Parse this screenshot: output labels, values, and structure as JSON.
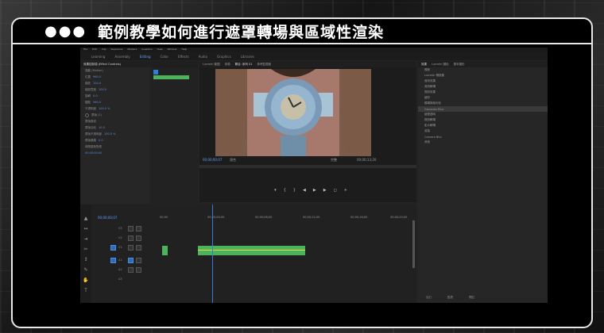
{
  "header": {
    "dots": "●●●",
    "title": "範例教學如何進行遮罩轉場與區域性渲染"
  },
  "menu": [
    "File",
    "Edit",
    "Clip",
    "Sequence",
    "Markers",
    "Graphics",
    "View",
    "Window",
    "Help"
  ],
  "workspaces": [
    "Learning",
    "Assembly",
    "Editing",
    "Color",
    "Effects",
    "Audio",
    "Graphics",
    "Libraries"
  ],
  "effect_controls": {
    "tab": "效果控制項 (Effect Controls)",
    "timecode": "00:00:00:00",
    "rows": [
      "運動 (Motion)",
      "位置",
      "縮放",
      "縮放寬度",
      "旋轉",
      "錨點",
      "不透明度",
      "蒙版 (1)",
      "蒙版路徑",
      "蒙版羽化",
      "蒙版不透明度",
      "蒙版擴展",
      "時間重新對應"
    ],
    "values": [
      "960.0",
      "100.0",
      "100.0",
      "0.0",
      "960.0",
      "100.0 %",
      "",
      "",
      "10.0",
      "100.0 %",
      "0.0"
    ]
  },
  "monitor": {
    "tabs": [
      "Lumetri 範圍",
      "來源",
      "節目: 序列 01",
      "參考監視器"
    ],
    "tc_left": "00;00;00;07",
    "fit": "適合",
    "quality": "完整",
    "tc_right": "00;00;13;20"
  },
  "project": {
    "tabs": [
      "效果",
      "Lumetri 顏色",
      "基本圖形"
    ],
    "items": [
      "預設",
      "Lumetri 預設集",
      "音訊效果",
      "音訊轉場",
      "視訊效果",
      "變形",
      "模糊與銳利化",
      "Gaussian Blur",
      "變更過時",
      "視訊轉場",
      "影片轉場",
      "溶接",
      "Camera Blur",
      "其他"
    ],
    "footer": [
      "自訂",
      "監看",
      "標記"
    ]
  },
  "timeline": {
    "timecode": "00;00;00;07",
    "ruler": [
      "00;00",
      "00;00;04;00",
      "00;00;08;00",
      "00;00;12;00",
      "00;00;16;00",
      "00;00;20;00"
    ],
    "tracks": [
      "V3",
      "V2",
      "V1",
      "A1",
      "A2",
      "A3"
    ]
  }
}
